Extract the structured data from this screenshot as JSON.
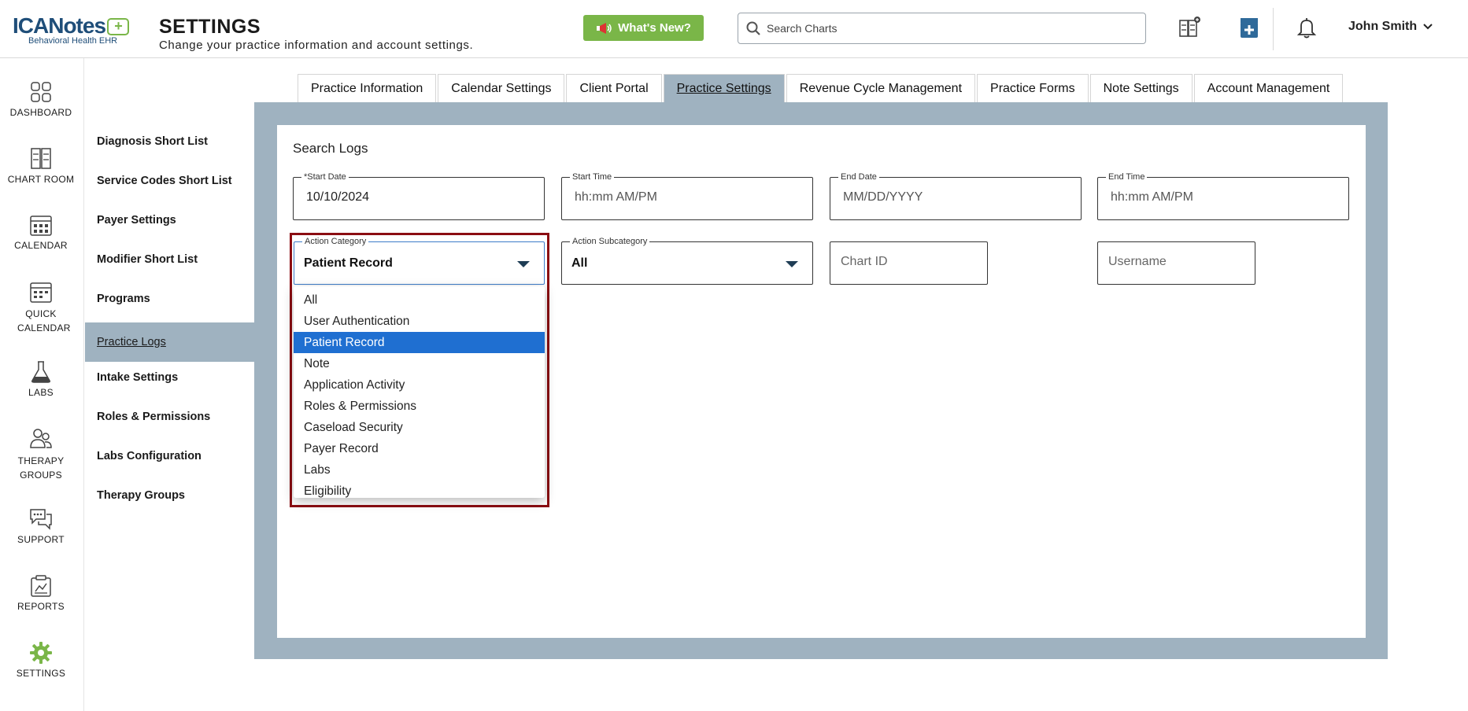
{
  "header": {
    "logo_main": "ICANotes",
    "logo_plus": "+",
    "logo_sub": "Behavioral Health EHR",
    "title": "SETTINGS",
    "subtitle": "Change your practice information and account settings.",
    "whats_new": "What's New?",
    "search_placeholder": "Search Charts",
    "user_name": "John Smith",
    "icons": [
      "chart-add-icon",
      "pharmacy-icon",
      "bell-icon",
      "chevron-down-icon"
    ]
  },
  "leftnav": {
    "items": [
      {
        "label": "DASHBOARD",
        "icon": "dashboard-icon"
      },
      {
        "label": "CHART ROOM",
        "icon": "chart-room-icon"
      },
      {
        "label": "CALENDAR",
        "icon": "calendar-icon"
      },
      {
        "label": "QUICK CALENDAR",
        "icon": "quick-calendar-icon"
      },
      {
        "label": "LABS",
        "icon": "flask-icon"
      },
      {
        "label": "THERAPY GROUPS",
        "icon": "group-icon"
      },
      {
        "label": "SUPPORT",
        "icon": "support-icon"
      },
      {
        "label": "REPORTS",
        "icon": "reports-icon"
      },
      {
        "label": "SETTINGS",
        "icon": "gear-icon"
      }
    ]
  },
  "submenu": {
    "items": [
      "Diagnosis Short List",
      "Service Codes Short List",
      "Payer Settings",
      "Modifier Short List",
      "Programs",
      "Practice Logs",
      "Intake Settings",
      "Roles & Permissions",
      "Labs Configuration",
      "Therapy Groups"
    ],
    "active": "Practice Logs"
  },
  "tabs": {
    "items": [
      "Practice Information",
      "Calendar Settings",
      "Client Portal",
      "Practice Settings",
      "Revenue Cycle Management",
      "Practice Forms",
      "Note Settings",
      "Account Management"
    ],
    "active": "Practice Settings"
  },
  "search_logs": {
    "title": "Search Logs",
    "start_date": {
      "label": "*Start Date",
      "value": "10/10/2024"
    },
    "start_time": {
      "label": "Start Time",
      "placeholder": "hh:mm AM/PM"
    },
    "end_date": {
      "label": "End Date",
      "placeholder": "MM/DD/YYYY"
    },
    "end_time": {
      "label": "End Time",
      "placeholder": "hh:mm AM/PM"
    },
    "action_category": {
      "label": "Action Category",
      "value": "Patient Record"
    },
    "action_subcategory": {
      "label": "Action Subcategory",
      "value": "All"
    },
    "chart_id": {
      "placeholder": "Chart ID"
    },
    "username": {
      "placeholder": "Username"
    },
    "category_options": [
      "All",
      "User Authentication",
      "Patient Record",
      "Note",
      "Application Activity",
      "Roles & Permissions",
      "Caseload Security",
      "Payer Record",
      "Labs",
      "Eligibility"
    ],
    "selected_option": "Patient Record"
  },
  "colors": {
    "brand_green": "#7ab648",
    "brand_blue": "#1f4e79",
    "panel_bg": "#9fb2c0",
    "selected_option": "#1f6fd1",
    "highlight_border": "#8b0d12"
  }
}
